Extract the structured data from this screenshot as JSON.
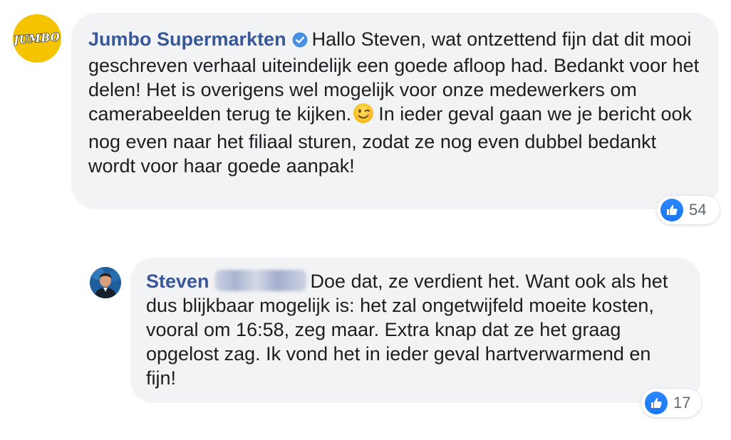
{
  "comments": [
    {
      "author": "Jumbo Supermarkten",
      "avatar_text": "JUMBO",
      "verified": true,
      "text_before_emoji": "Hallo Steven, wat ontzettend fijn dat dit mooi geschreven verhaal uiteindelijk een goede afloop had. Bedankt voor het delen! Het is overigens wel mogelijk voor onze medewerkers om camerabeelden terug te kijken.",
      "emoji": "winking-face",
      "text_after_emoji": "In ieder geval gaan we je bericht ook nog even naar het filiaal sturen, zodat ze nog even dubbel bedankt wordt voor haar goede aanpak!",
      "reaction_icon": "like-icon",
      "reaction_count": "54"
    },
    {
      "author": "Steven",
      "surname_redacted": true,
      "text": "Doe dat, ze verdient het. Want ook als het dus blijkbaar mogelijk is: het zal ongetwijfeld moeite kosten, vooral om 16:58, zeg maar. Extra knap dat ze het graag opgelost zag. Ik vond het in ieder geval hartverwarmend en fijn!",
      "reaction_icon": "like-icon",
      "reaction_count": "17"
    }
  ],
  "colors": {
    "author_link": "#385898",
    "bubble_bg": "#f2f3f5",
    "like_blue": "#1877f2",
    "jumbo_yellow": "#f5c400",
    "verified_blue": "#4a90e2"
  }
}
